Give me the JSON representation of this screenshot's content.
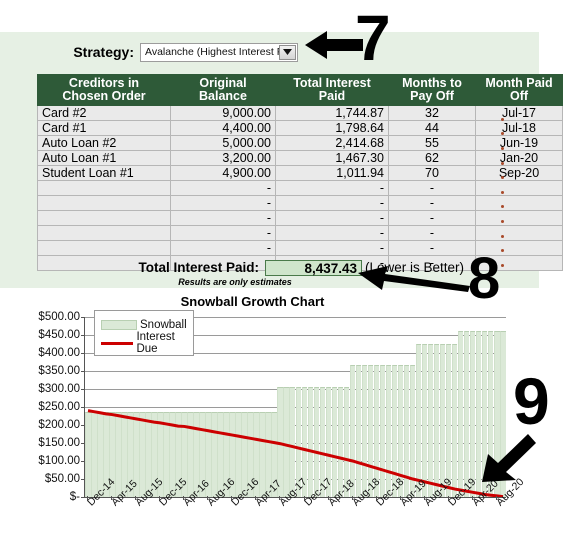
{
  "strategy": {
    "label": "Strategy:",
    "value": "Avalanche (Highest Interest Firs",
    "dropdown_icon": "chevron-down-icon"
  },
  "table": {
    "headers": [
      "Creditors in Chosen Order",
      "Original Balance",
      "Total Interest Paid",
      "Months to Pay Off",
      "Month Paid Off"
    ],
    "header_lines": [
      [
        "Creditors in",
        "Chosen Order"
      ],
      [
        "Original",
        "Balance"
      ],
      [
        "Total Interest",
        "Paid"
      ],
      [
        "Months to",
        "Pay Off"
      ],
      [
        "Month Paid",
        "Off"
      ]
    ],
    "rows": [
      [
        "Card #2",
        "9,000.00",
        "1,744.87",
        "32",
        "Jul-17"
      ],
      [
        "Card #1",
        "4,400.00",
        "1,798.64",
        "44",
        "Jul-18"
      ],
      [
        "Auto Loan #2",
        "5,000.00",
        "2,414.68",
        "55",
        "Jun-19"
      ],
      [
        "Auto Loan #1",
        "3,200.00",
        "1,467.30",
        "62",
        "Jan-20"
      ],
      [
        "Student Loan #1",
        "4,900.00",
        "1,011.94",
        "70",
        "Sep-20"
      ],
      [
        "",
        "-",
        "-",
        "-",
        ""
      ],
      [
        "",
        "-",
        "-",
        "-",
        ""
      ],
      [
        "",
        "-",
        "-",
        "-",
        ""
      ],
      [
        "",
        "-",
        "-",
        "-",
        ""
      ],
      [
        "",
        "-",
        "-",
        "-",
        ""
      ],
      [
        "",
        "-",
        "-",
        "-",
        ""
      ]
    ]
  },
  "totals": {
    "label": "Total Interest Paid:",
    "value": "8,437.43",
    "note": "(Lower is Better)",
    "estimates_note": "Results are only estimates"
  },
  "annotations": [
    {
      "name": "annotation-7",
      "text": "7"
    },
    {
      "name": "annotation-8",
      "text": "8"
    },
    {
      "name": "annotation-9",
      "text": "9"
    }
  ],
  "colors": {
    "panel_bg": "#e6f0e4",
    "header_green": "#2e5a38",
    "snowball_fill": "#dbe9d7",
    "interest_line": "#cc0000",
    "total_cell": "#cfe5cb"
  },
  "chart_data": {
    "type": "bar",
    "title": "Snowball Growth Chart",
    "xlabel": "",
    "ylabel": "",
    "ylim": [
      0,
      500
    ],
    "yticks": [
      0,
      50,
      100,
      150,
      200,
      250,
      300,
      350,
      400,
      450,
      500
    ],
    "ytick_labels": [
      "$-",
      "$50.00",
      "$100.00",
      "$150.00",
      "$200.00",
      "$250.00",
      "$300.00",
      "$350.00",
      "$400.00",
      "$450.00",
      "$500.00"
    ],
    "grid": true,
    "legend": [
      "Snowball",
      "Interest Due"
    ],
    "legend_position": "upper left",
    "x": [
      "Dec-14",
      "Jan-15",
      "Feb-15",
      "Mar-15",
      "Apr-15",
      "May-15",
      "Jun-15",
      "Jul-15",
      "Aug-15",
      "Sep-15",
      "Oct-15",
      "Nov-15",
      "Dec-15",
      "Jan-16",
      "Feb-16",
      "Mar-16",
      "Apr-16",
      "May-16",
      "Jun-16",
      "Jul-16",
      "Aug-16",
      "Sep-16",
      "Oct-16",
      "Nov-16",
      "Dec-16",
      "Jan-17",
      "Feb-17",
      "Mar-17",
      "Apr-17",
      "May-17",
      "Jun-17",
      "Jul-17",
      "Aug-17",
      "Sep-17",
      "Oct-17",
      "Nov-17",
      "Dec-17",
      "Jan-18",
      "Feb-18",
      "Mar-18",
      "Apr-18",
      "May-18",
      "Jun-18",
      "Jul-18",
      "Aug-18",
      "Sep-18",
      "Oct-18",
      "Nov-18",
      "Dec-18",
      "Jan-19",
      "Feb-19",
      "Mar-19",
      "Apr-19",
      "May-19",
      "Jun-19",
      "Jul-19",
      "Aug-19",
      "Sep-19",
      "Oct-19",
      "Nov-19",
      "Dec-19",
      "Jan-20",
      "Feb-20",
      "Mar-20",
      "Apr-20",
      "May-20",
      "Jun-20",
      "Jul-20",
      "Aug-20",
      "Sep-20"
    ],
    "xtick_labels": [
      "Dec-14",
      "Apr-15",
      "Aug-15",
      "Dec-15",
      "Apr-16",
      "Aug-16",
      "Dec-16",
      "Apr-17",
      "Aug-17",
      "Dec-17",
      "Apr-18",
      "Aug-18",
      "Dec-18",
      "Apr-19",
      "Aug-19",
      "Dec-19",
      "Apr-20",
      "Aug-20"
    ],
    "xtick_indices": [
      0,
      4,
      8,
      12,
      16,
      20,
      24,
      28,
      32,
      36,
      40,
      44,
      48,
      52,
      56,
      60,
      64,
      68
    ],
    "series": [
      {
        "name": "Snowball",
        "type": "bar",
        "values": [
          237,
          237,
          237,
          237,
          237,
          237,
          237,
          237,
          237,
          237,
          237,
          237,
          237,
          237,
          237,
          237,
          237,
          237,
          237,
          237,
          237,
          237,
          237,
          237,
          237,
          237,
          237,
          237,
          237,
          237,
          237,
          237,
          305,
          305,
          305,
          305,
          305,
          305,
          305,
          305,
          305,
          305,
          305,
          305,
          368,
          368,
          368,
          368,
          368,
          368,
          368,
          368,
          368,
          368,
          368,
          425,
          425,
          425,
          425,
          425,
          425,
          425,
          462,
          462,
          462,
          462,
          462,
          462,
          462,
          462
        ]
      },
      {
        "name": "Interest Due",
        "type": "line",
        "values": [
          240,
          237,
          234,
          231,
          229,
          226,
          223,
          220,
          217,
          214,
          211,
          208,
          206,
          203,
          200,
          197,
          196,
          193,
          190,
          187,
          184,
          181,
          178,
          175,
          172,
          169,
          166,
          163,
          160,
          157,
          154,
          151,
          148,
          144,
          140,
          136,
          132,
          128,
          124,
          120,
          116,
          112,
          108,
          104,
          100,
          95,
          90,
          85,
          80,
          75,
          70,
          65,
          60,
          55,
          50,
          46,
          42,
          38,
          34,
          30,
          26,
          22,
          19,
          16,
          13,
          10,
          7,
          5,
          3,
          1
        ]
      }
    ]
  }
}
